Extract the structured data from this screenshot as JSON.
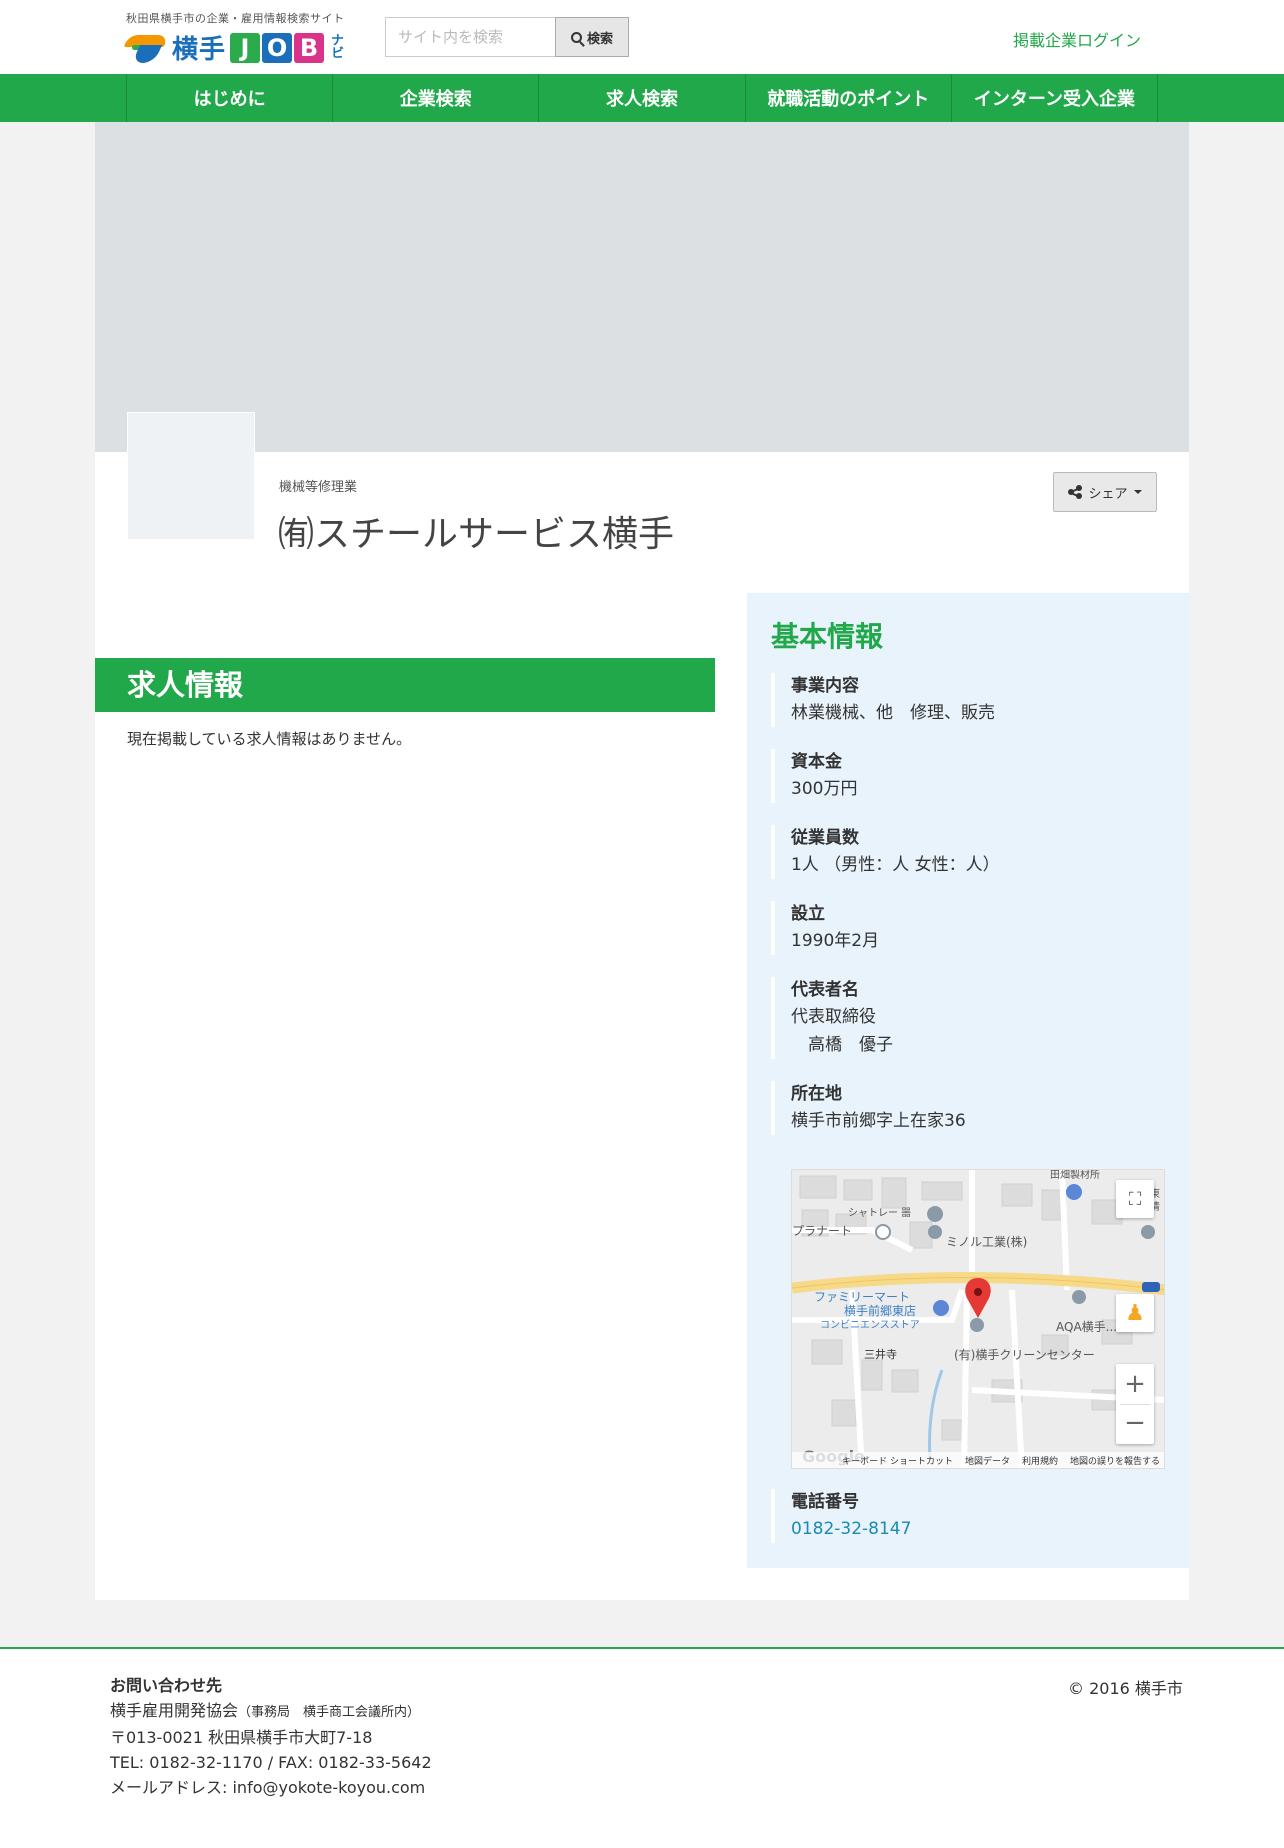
{
  "header": {
    "tagline": "秋田県横手市の企業・雇用情報検索サイト",
    "logo_name": "横手",
    "logo_job": [
      "J",
      "O",
      "B"
    ],
    "logo_navi": "ナビ",
    "search_placeholder": "サイト内を検索",
    "search_button": "検索",
    "login_link": "掲載企業ログイン"
  },
  "nav": {
    "items": [
      {
        "label": "はじめに"
      },
      {
        "label": "企業検索"
      },
      {
        "label": "求人検索"
      },
      {
        "label": "就職活動のポイント"
      },
      {
        "label": "インターン受入企業"
      }
    ]
  },
  "company": {
    "category": "機械等修理業",
    "name": "㈲スチールサービス横手",
    "share_button": "シェア"
  },
  "jobs": {
    "heading": "求人情報",
    "empty_message": "現在掲載している求人情報はありません。"
  },
  "info": {
    "title": "基本情報",
    "business_label": "事業内容",
    "business_value": "林業機械、他　修理、販売",
    "capital_label": "資本金",
    "capital_value": "300万円",
    "employees_label": "従業員数",
    "employees_value": "1人 （男性：人 女性：人）",
    "founded_label": "設立",
    "founded_value": "1990年2月",
    "rep_label": "代表者名",
    "rep_title": "代表取締役",
    "rep_name": "　高橋　優子",
    "address_label": "所在地",
    "address_value": "横手市前郷字上在家36",
    "phone_label": "電話番号",
    "phone_value": "0182-32-8147"
  },
  "map": {
    "labels": {
      "shatore": "シャトレー 噐",
      "planart": "プラナート",
      "minoru": "ミノル工業(株)",
      "familymart": "ファミリーマート",
      "familymart2": "横手前郷東店",
      "familymart3": "コンビニエンスストア",
      "aqa": "AQA横手...",
      "mitsui": "三井寺",
      "cleancenter": "(有)横手クリーンセンター",
      "top_right": "東 清",
      "top_center": "田畑製材所"
    },
    "footer": [
      "キーボード ショートカット",
      "地図データ",
      "利用規約",
      "地図の誤りを報告する"
    ],
    "google": "Google",
    "zoom_in": "+",
    "zoom_out": "−"
  },
  "footer": {
    "contact_heading": "お問い合わせ先",
    "org": "横手雇用開発協会",
    "org_note": "（事務局　横手商工会議所内）",
    "address": "〒013-0021 秋田県横手市大町7-18",
    "tel_fax": "TEL: 0182-32-1170 / FAX: 0182-33-5642",
    "email": "メールアドレス: info@yokote-koyou.com",
    "copyright": "© 2016 横手市"
  }
}
